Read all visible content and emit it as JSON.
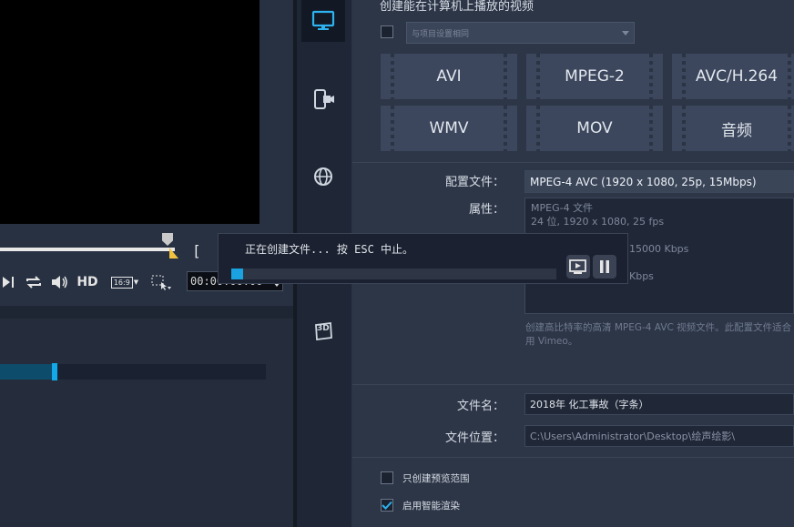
{
  "player": {
    "hd_label": "HD",
    "aspect_label": "16:9",
    "timecode": "00:00:00:00",
    "bracket": "[",
    "render_progress": 0.2
  },
  "sidebar": {
    "icons": [
      "computer-icon",
      "mobile-device-icon",
      "web-globe-icon",
      "3d-icon"
    ],
    "label_3d": "3D"
  },
  "output": {
    "section_title": "创建能在计算机上播放的视频",
    "match_project_placeholder": "与项目设置相同",
    "formats": [
      "AVI",
      "MPEG-2",
      "AVC/H.264",
      "WMV",
      "MOV",
      "音频"
    ],
    "profile_label": "配置文件：",
    "profile_value": "MPEG-4 AVC (1920 x 1080, 25p, 15Mbps)",
    "properties_label": "属性：",
    "properties_lines": [
      "MPEG-4 文件",
      "24 位, 1920 x 1080, 25 fps",
      "",
      "15000 Kbps",
      "",
      "Kbps"
    ],
    "description": "创建高比特率的高清 MPEG-4 AVC 视频文件。此配置文件适合用 Vimeo。",
    "filename_label": "文件名：",
    "filename_value": "2018年 化工事故（字条）",
    "filepath_label": "文件位置：",
    "filepath_value": "C:\\Users\\Administrator\\Desktop\\绘声绘影\\",
    "opt_preview_range": "只创建预览范围",
    "opt_smart_render": "启用智能渲染",
    "opt_smart_render_checked": true
  },
  "render_dialog": {
    "message": "正在创建文件... 按 ESC 中止。",
    "progress": 0.036
  },
  "colors": {
    "accent": "#1aa3e0",
    "panel": "#2d3647",
    "dark": "#1b2130"
  }
}
